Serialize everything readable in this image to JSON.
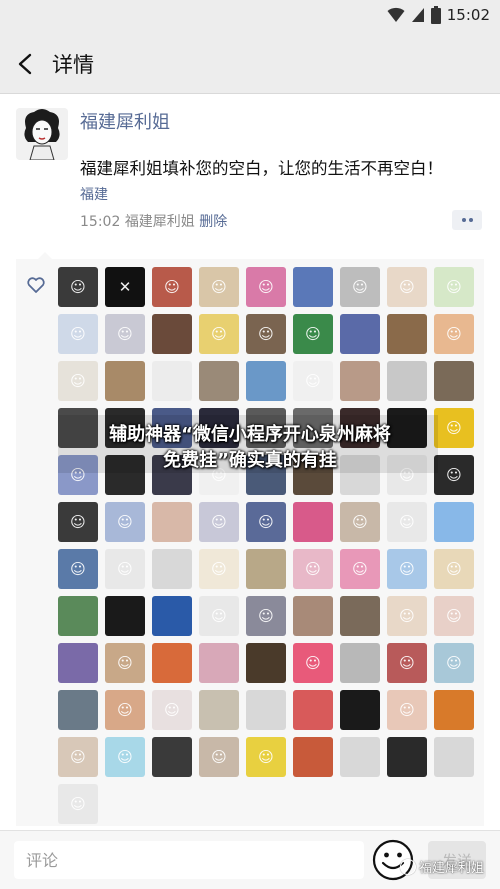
{
  "status_bar": {
    "time": "15:02"
  },
  "nav": {
    "title": "详情"
  },
  "post": {
    "author": "福建犀利姐",
    "text": "福建犀利姐填补您的空白，让您的生活不再空白！",
    "location": "福建",
    "time": "15:02",
    "meta_author": "福建犀利姐",
    "delete_label": "删除"
  },
  "likes": {
    "avatars": [
      {
        "c": "#3a3a3a",
        "g": "☺"
      },
      {
        "c": "#111111",
        "g": "✕"
      },
      {
        "c": "#b85a4a",
        "g": "☺"
      },
      {
        "c": "#d9c6a8",
        "g": "☺"
      },
      {
        "c": "#d97aa8",
        "g": "☺"
      },
      {
        "c": "#5a78b8",
        "g": ""
      },
      {
        "c": "#bdbdbd",
        "g": "☺"
      },
      {
        "c": "#e8d8c8",
        "g": "☺"
      },
      {
        "c": "#d6e8c8",
        "g": "☺"
      },
      {
        "c": "#cfd9e8",
        "g": "☺"
      },
      {
        "c": "#c9c9d4",
        "g": "☺"
      },
      {
        "c": "#6a4a3a",
        "g": ""
      },
      {
        "c": "#e8d070",
        "g": "☺"
      },
      {
        "c": "#7a6450",
        "g": "☺"
      },
      {
        "c": "#3a8a4a",
        "g": "☺"
      },
      {
        "c": "#5a6aa8",
        "g": ""
      },
      {
        "c": "#8a6a4a",
        "g": ""
      },
      {
        "c": "#e8b890",
        "g": "☺"
      },
      {
        "c": "#e6e2da",
        "g": "☺"
      },
      {
        "c": "#a88a68",
        "g": ""
      },
      {
        "c": "#ececec",
        "g": ""
      },
      {
        "c": "#9a8a78",
        "g": ""
      },
      {
        "c": "#6a98c8",
        "g": ""
      },
      {
        "c": "#f0f0f0",
        "g": "☺"
      },
      {
        "c": "#b89a88",
        "g": ""
      },
      {
        "c": "#c8c8c8",
        "g": ""
      },
      {
        "c": "#7a6a58",
        "g": ""
      },
      {
        "c": "#4a4a4a",
        "g": ""
      },
      {
        "c": "#2a2a2a",
        "g": ""
      },
      {
        "c": "#4a5a88",
        "g": ""
      },
      {
        "c": "#2a2a3a",
        "g": ""
      },
      {
        "c": "#5a5a5a",
        "g": ""
      },
      {
        "c": "#6a6a6a",
        "g": ""
      },
      {
        "c": "#3a2a2a",
        "g": ""
      },
      {
        "c": "#1a1a1a",
        "g": ""
      },
      {
        "c": "#e8c020",
        "g": "☺"
      },
      {
        "c": "#8a98c8",
        "g": "☺"
      },
      {
        "c": "#2a2a2a",
        "g": ""
      },
      {
        "c": "#3a3a4a",
        "g": ""
      },
      {
        "c": "#f0f0f0",
        "g": "☺"
      },
      {
        "c": "#4a5a78",
        "g": ""
      },
      {
        "c": "#5a4a3a",
        "g": ""
      },
      {
        "c": "#d8d8d8",
        "g": ""
      },
      {
        "c": "#e8e8e8",
        "g": "☺"
      },
      {
        "c": "#2a2a2a",
        "g": "☺"
      },
      {
        "c": "#3a3a3a",
        "g": "☺"
      },
      {
        "c": "#a8b8d8",
        "g": "☺"
      },
      {
        "c": "#d8b8a8",
        "g": ""
      },
      {
        "c": "#c8c8d8",
        "g": "☺"
      },
      {
        "c": "#5a6a98",
        "g": "☺"
      },
      {
        "c": "#d85a8a",
        "g": ""
      },
      {
        "c": "#c8b8a8",
        "g": "☺"
      },
      {
        "c": "#e8e8e8",
        "g": "☺"
      },
      {
        "c": "#88b8e8",
        "g": ""
      },
      {
        "c": "#5a7aa8",
        "g": "☺"
      },
      {
        "c": "#e8e8e8",
        "g": "☺"
      },
      {
        "c": "#d8d8d8",
        "g": ""
      },
      {
        "c": "#f0e8d8",
        "g": "☺"
      },
      {
        "c": "#b8a888",
        "g": ""
      },
      {
        "c": "#e8b8c8",
        "g": "☺"
      },
      {
        "c": "#e898b8",
        "g": "☺"
      },
      {
        "c": "#a8c8e8",
        "g": "☺"
      },
      {
        "c": "#e8d8b8",
        "g": "☺"
      },
      {
        "c": "#5a8a5a",
        "g": ""
      },
      {
        "c": "#1a1a1a",
        "g": ""
      },
      {
        "c": "#2a5aa8",
        "g": ""
      },
      {
        "c": "#e8e8e8",
        "g": "☺"
      },
      {
        "c": "#8a8a9a",
        "g": "☺"
      },
      {
        "c": "#a88a78",
        "g": ""
      },
      {
        "c": "#7a6a5a",
        "g": ""
      },
      {
        "c": "#e8d8c8",
        "g": "☺"
      },
      {
        "c": "#e8d0c8",
        "g": "☺"
      },
      {
        "c": "#7a6aa8",
        "g": ""
      },
      {
        "c": "#c8a888",
        "g": "☺"
      },
      {
        "c": "#d86a3a",
        "g": ""
      },
      {
        "c": "#d8a8b8",
        "g": ""
      },
      {
        "c": "#4a3a2a",
        "g": ""
      },
      {
        "c": "#e85a7a",
        "g": "☺"
      },
      {
        "c": "#b8b8b8",
        "g": ""
      },
      {
        "c": "#b85a5a",
        "g": "☺"
      },
      {
        "c": "#a8c8d8",
        "g": "☺"
      },
      {
        "c": "#6a7a88",
        "g": ""
      },
      {
        "c": "#d8a888",
        "g": "☺"
      },
      {
        "c": "#e8e0e0",
        "g": "☺"
      },
      {
        "c": "#c8c0b0",
        "g": ""
      },
      {
        "c": "#d8d8d8",
        "g": ""
      },
      {
        "c": "#d85a5a",
        "g": ""
      },
      {
        "c": "#1a1a1a",
        "g": ""
      },
      {
        "c": "#e8c8b8",
        "g": "☺"
      },
      {
        "c": "#d87a2a",
        "g": ""
      },
      {
        "c": "#d8c8b8",
        "g": "☺"
      },
      {
        "c": "#a8d8e8",
        "g": "☺"
      },
      {
        "c": "#3a3a3a",
        "g": ""
      },
      {
        "c": "#c8b8a8",
        "g": "☺"
      },
      {
        "c": "#e8d040",
        "g": "☺"
      },
      {
        "c": "#c85a3a",
        "g": ""
      },
      {
        "c": "#d8d8d8",
        "g": ""
      },
      {
        "c": "#2a2a2a",
        "g": ""
      },
      {
        "c": "#d8d8d8",
        "g": ""
      },
      {
        "c": "#e8e8e8",
        "g": "☺"
      }
    ]
  },
  "overlay": {
    "line1": "辅助神器“微信小程序开心泉州麻将",
    "line2": "免费挂”确实真的有挂"
  },
  "comment_bar": {
    "placeholder": "评论",
    "send_label": "发送"
  },
  "watermark": {
    "text": "福建犀利姐"
  }
}
